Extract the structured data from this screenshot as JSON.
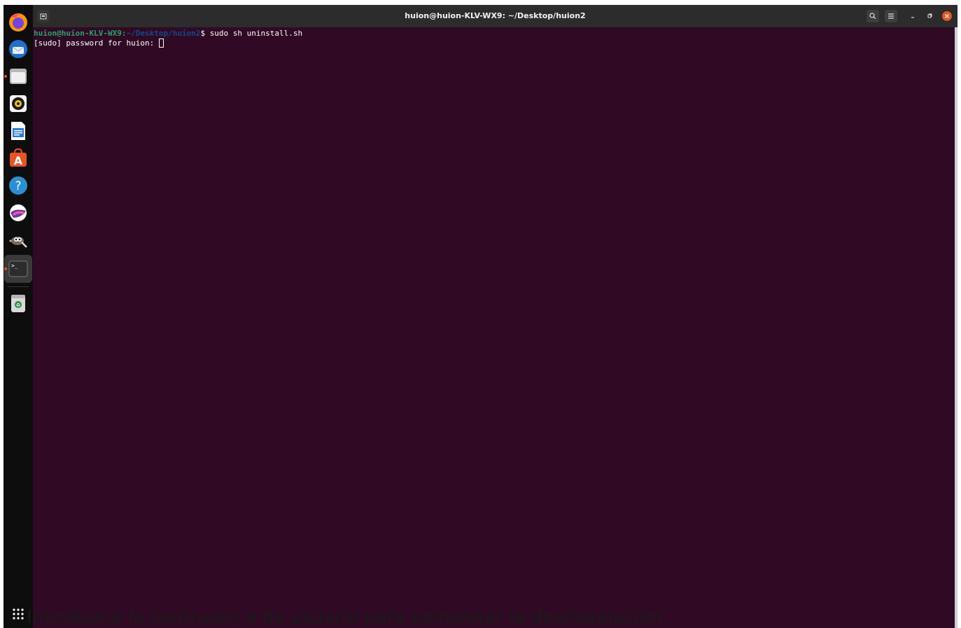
{
  "window": {
    "title": "huion@huion-KLV-WX9: ~/Desktop/huion2"
  },
  "terminal": {
    "line1": {
      "user_host": "huion@huion-KLV-WX9",
      "colon": ":",
      "path": "~/Desktop/huion2",
      "dollar": "$ ",
      "command": "sudo sh uninstall.sh"
    },
    "line2": "[sudo] password for huion: "
  },
  "dock": {
    "items": [
      "firefox-icon",
      "thunderbird-icon",
      "files-icon",
      "rhythmbox-icon",
      "libreoffice-writer-icon",
      "ubuntu-software-icon",
      "help-icon",
      "krita-icon",
      "gimp-icon",
      "terminal-icon",
      "trash-icon"
    ],
    "active": "terminal-icon"
  },
  "caption": "Introduzca la contrase▯ a de usuario para completar la desinstalación",
  "colors": {
    "terminal_bg": "#300a24",
    "accent": "#e95420",
    "prompt_user": "#26a269",
    "prompt_path": "#12488b"
  }
}
